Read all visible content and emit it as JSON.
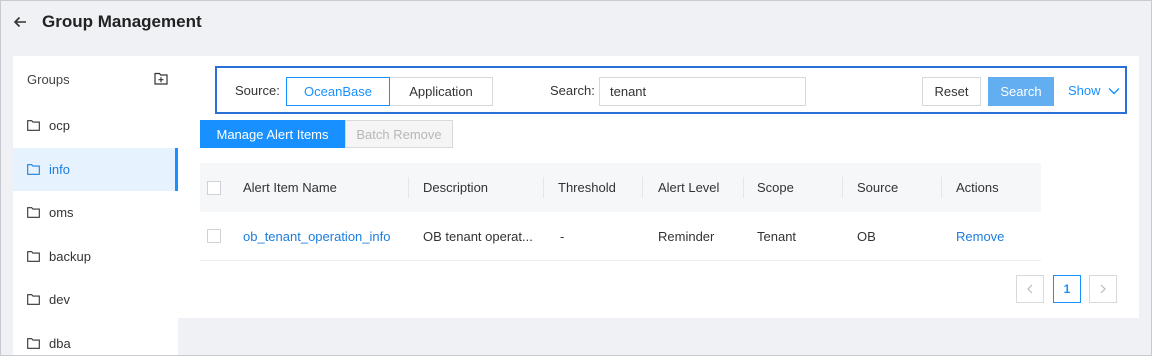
{
  "header": {
    "title": "Group Management"
  },
  "sidebar": {
    "heading": "Groups",
    "items": [
      {
        "label": "ocp",
        "active": false
      },
      {
        "label": "info",
        "active": true
      },
      {
        "label": "oms",
        "active": false
      },
      {
        "label": "backup",
        "active": false
      },
      {
        "label": "dev",
        "active": false
      },
      {
        "label": "dba",
        "active": false
      }
    ]
  },
  "filters": {
    "source_label": "Source:",
    "source_options": [
      "OceanBase",
      "Application"
    ],
    "source_selected": "OceanBase",
    "search_label": "Search:",
    "search_value": "tenant",
    "reset_label": "Reset",
    "search_button_label": "Search",
    "show_label": "Show"
  },
  "actions": {
    "manage_label": "Manage Alert Items",
    "batch_remove_label": "Batch Remove"
  },
  "table": {
    "columns": [
      "Alert Item Name",
      "Description",
      "Threshold",
      "Alert Level",
      "Scope",
      "Source",
      "Actions"
    ],
    "rows": [
      {
        "name": "ob_tenant_operation_info",
        "description": "OB tenant operat...",
        "threshold": "-",
        "level": "Reminder",
        "scope": "Tenant",
        "source": "OB",
        "action": "Remove"
      }
    ]
  },
  "pagination": {
    "current": "1"
  },
  "colors": {
    "accent": "#1890ff",
    "search_button": "#63aef0",
    "active_bg": "#e6f2fd",
    "highlight_border": "#2a6fd6"
  },
  "icons": {
    "back": "arrow-left-icon",
    "add_folder": "folder-add-icon",
    "folder": "folder-icon",
    "show": "chevron-down-icon"
  }
}
